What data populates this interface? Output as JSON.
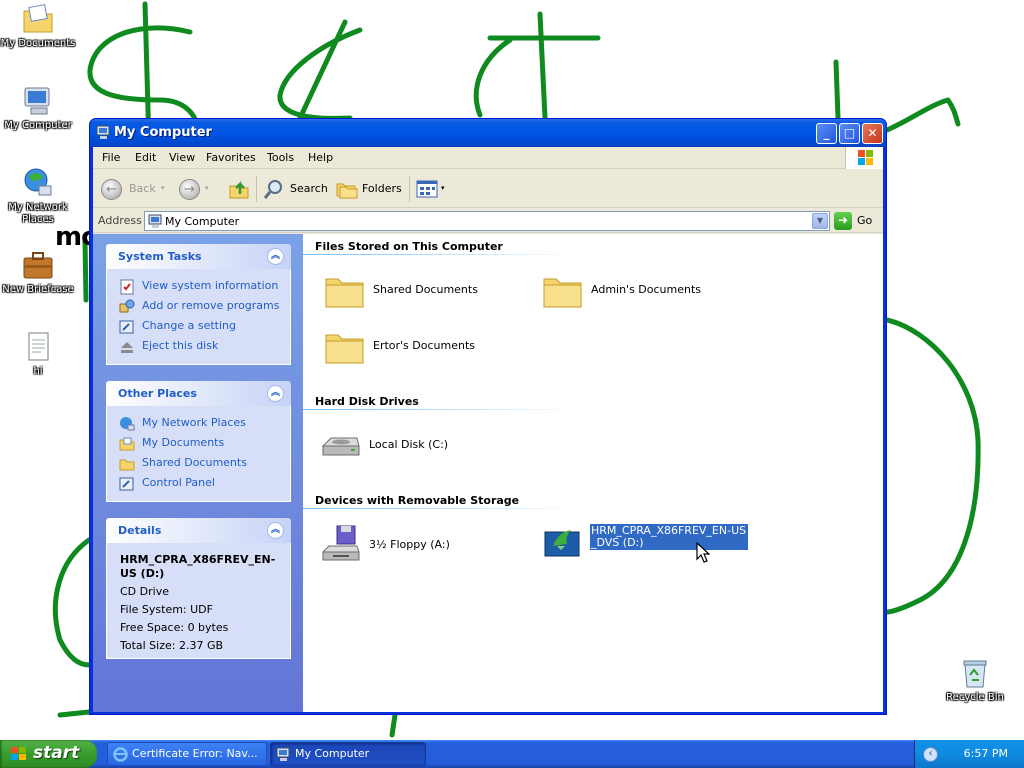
{
  "desktop": {
    "doodle_text": "mc",
    "icons": [
      {
        "label": "My Documents"
      },
      {
        "label": "My Computer"
      },
      {
        "label": "My Network Places"
      },
      {
        "label": "New Briefcase"
      },
      {
        "label": "hi"
      },
      {
        "label": "Recycle Bin"
      }
    ]
  },
  "window": {
    "title": "My Computer",
    "menu": [
      "File",
      "Edit",
      "View",
      "Favorites",
      "Tools",
      "Help"
    ],
    "toolbar": {
      "back": "Back",
      "search": "Search",
      "folders": "Folders"
    },
    "address": {
      "label": "Address",
      "value": "My Computer",
      "go": "Go"
    },
    "taskpane": {
      "system_tasks": {
        "title": "System Tasks",
        "items": [
          "View system information",
          "Add or remove programs",
          "Change a setting",
          "Eject this disk"
        ]
      },
      "other_places": {
        "title": "Other Places",
        "items": [
          "My Network Places",
          "My Documents",
          "Shared Documents",
          "Control Panel"
        ]
      },
      "details": {
        "title": "Details",
        "name": "HRM_CPRA_X86FREV_EN-US (D:)",
        "type": "CD Drive",
        "file_system": "File System: UDF",
        "free_space": "Free Space: 0 bytes",
        "total_size": "Total Size: 2.37 GB"
      }
    },
    "content": {
      "groups": [
        {
          "title": "Files Stored on This Computer",
          "items": [
            "Shared Documents",
            "Admin's Documents",
            "Ertor's Documents"
          ]
        },
        {
          "title": "Hard Disk Drives",
          "items": [
            "Local Disk (C:)"
          ]
        },
        {
          "title": "Devices with Removable Storage",
          "items": [
            "3½ Floppy (A:)",
            "HRM_CPRA_X86FREV_EN-US_DVS (D:)"
          ]
        }
      ]
    }
  },
  "taskbar": {
    "start": "start",
    "tasks": [
      "Certificate Error: Nav...",
      "My Computer"
    ],
    "clock": "6:57 PM"
  },
  "colors": {
    "doodle": "#0f8a1e",
    "titlebar": "#0055e5",
    "selection": "#316ac5",
    "link": "#215dc6"
  }
}
